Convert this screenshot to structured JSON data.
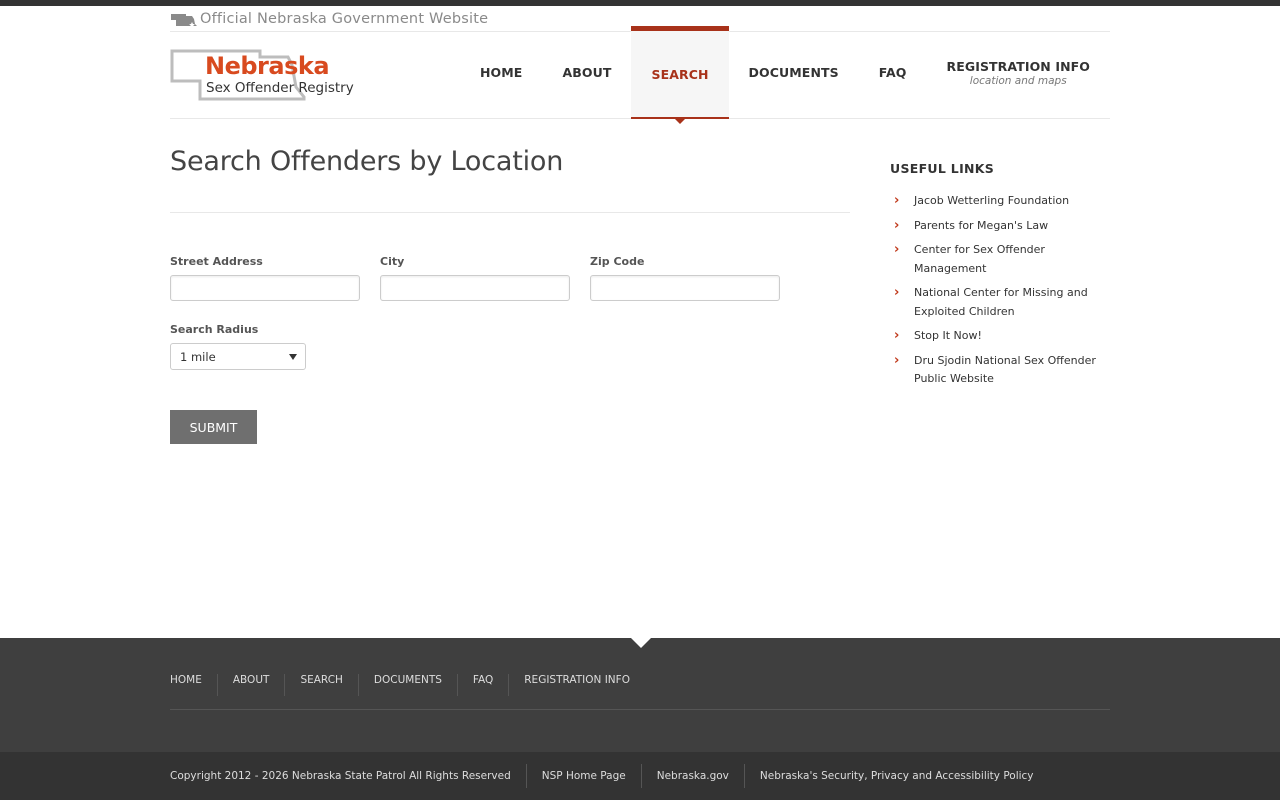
{
  "gov_banner": {
    "text": "Official Nebraska Government Website",
    "icon": "nebraska-state-icon"
  },
  "logo": {
    "title": "Nebraska",
    "subtitle": "Sex Offender Registry"
  },
  "nav": {
    "items": [
      {
        "label": "HOME",
        "sub": ""
      },
      {
        "label": "ABOUT",
        "sub": ""
      },
      {
        "label": "SEARCH",
        "sub": "",
        "active": true
      },
      {
        "label": "DOCUMENTS",
        "sub": ""
      },
      {
        "label": "FAQ",
        "sub": ""
      },
      {
        "label": "REGISTRATION INFO",
        "sub": "location and maps"
      }
    ]
  },
  "main": {
    "title": "Search Offenders by Location",
    "form": {
      "street_label": "Street Address",
      "street_value": "",
      "city_label": "City",
      "city_value": "",
      "zip_label": "Zip Code",
      "zip_value": "",
      "radius_label": "Search Radius",
      "radius_value": "1 mile",
      "submit_label": "SUBMIT"
    }
  },
  "sidebar": {
    "title": "USEFUL LINKS",
    "links": [
      "Jacob Wetterling Foundation",
      "Parents for Megan's Law",
      "Center for Sex Offender Management",
      "National Center for Missing and Exploited Children",
      "Stop It Now!",
      "Dru Sjodin National Sex Offender Public Website"
    ]
  },
  "footer": {
    "nav": [
      "HOME",
      "ABOUT",
      "SEARCH",
      "DOCUMENTS",
      "FAQ",
      "REGISTRATION INFO"
    ],
    "copyright": "Copyright 2012 - 2026 Nebraska State Patrol All Rights Reserved",
    "links": [
      "NSP Home Page",
      "Nebraska.gov",
      "Nebraska's Security, Privacy and Accessibility Policy"
    ]
  },
  "colors": {
    "accent": "#a8321a",
    "logo_orange": "#d84a1f",
    "footer_bg": "#3f3f3f",
    "footer_bottom_bg": "#333333",
    "submit_bg": "#6f6f6f"
  }
}
